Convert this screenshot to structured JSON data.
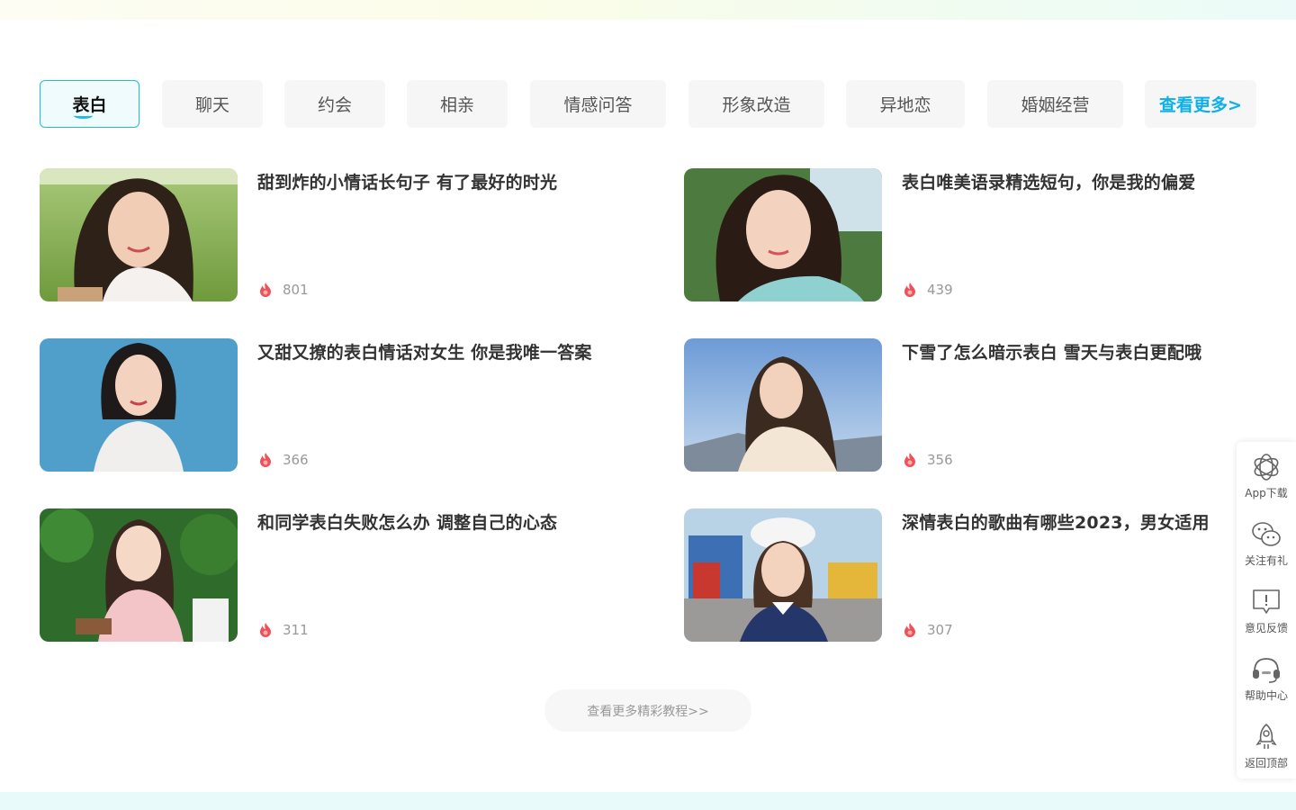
{
  "tabs": [
    {
      "label": "表白",
      "active": true
    },
    {
      "label": "聊天"
    },
    {
      "label": "约会"
    },
    {
      "label": "相亲"
    },
    {
      "label": "情感问答"
    },
    {
      "label": "形象改造"
    },
    {
      "label": "异地恋"
    },
    {
      "label": "婚姻经营"
    }
  ],
  "tabs_more_label": "查看更多>",
  "articles": [
    {
      "title": "甜到炸的小情话长句子 有了最好的时光",
      "views": "801"
    },
    {
      "title": "表白唯美语录精选短句，你是我的偏爱",
      "views": "439"
    },
    {
      "title": "又甜又撩的表白情话对女生 你是我唯一答案",
      "views": "366"
    },
    {
      "title": "下雪了怎么暗示表白 雪天与表白更配哦",
      "views": "356"
    },
    {
      "title": "和同学表白失败怎么办 调整自己的心态",
      "views": "311"
    },
    {
      "title": "深情表白的歌曲有哪些2023，男女适用",
      "views": "307"
    }
  ],
  "more_tutorials_label": "查看更多精彩教程>>",
  "sidebar": {
    "app_download": "App下载",
    "follow_gift": "关注有礼",
    "feedback": "意见反馈",
    "help_center": "帮助中心",
    "back_to_top": "返回顶部"
  },
  "colors": {
    "accent": "#1fbfd6",
    "more_link": "#0fb0e8",
    "flame": "#f0505a"
  }
}
